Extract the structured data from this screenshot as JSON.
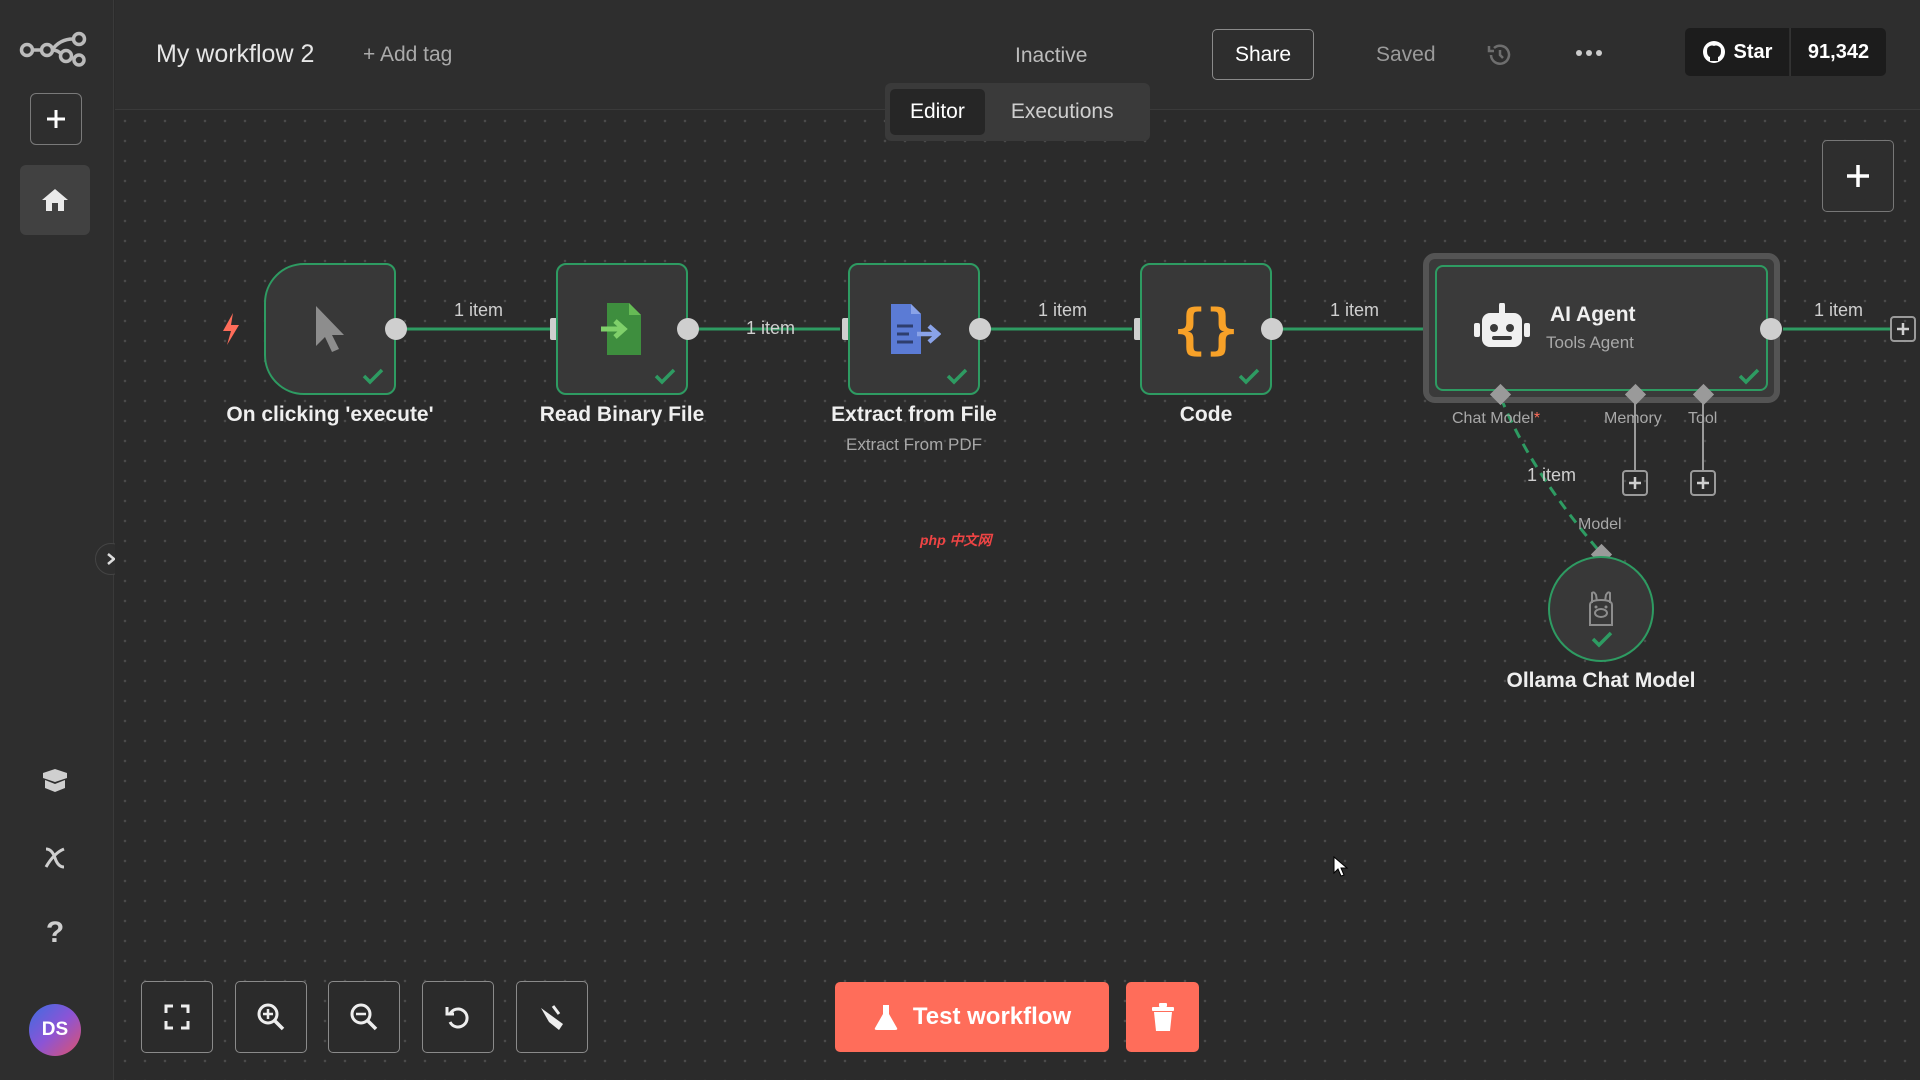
{
  "header": {
    "workflow_title": "My workflow 2",
    "add_tag": "+ Add tag",
    "status_label": "Inactive",
    "active": false,
    "share_label": "Share",
    "saved_label": "Saved",
    "github": {
      "star_label": "Star",
      "star_count": "91,342"
    }
  },
  "tabs": [
    {
      "label": "Editor",
      "active": true
    },
    {
      "label": "Executions",
      "active": false
    }
  ],
  "sidebar": {
    "items": [
      "add",
      "home",
      "templates",
      "variables",
      "help"
    ],
    "avatar_initials": "DS"
  },
  "nodes": {
    "trigger": {
      "label": "On clicking 'execute'"
    },
    "read_binary": {
      "label": "Read Binary File"
    },
    "extract": {
      "label": "Extract from File",
      "sublabel": "Extract From PDF"
    },
    "code": {
      "label": "Code"
    },
    "agent": {
      "label": "AI Agent",
      "sublabel": "Tools Agent",
      "inputs": {
        "chat_model": "Chat Model",
        "required_mark": "*",
        "memory": "Memory",
        "tool": "Tool"
      }
    },
    "ollama": {
      "label": "Ollama Chat Model",
      "input_label": "Model"
    }
  },
  "edges": {
    "e1": "1 item",
    "e2": "1 item",
    "e3": "1 item",
    "e4": "1 item",
    "e5": "1 item",
    "model_edge": "1 item"
  },
  "toolbar": {
    "test_label": "Test workflow"
  },
  "watermark": "php 中文网",
  "colors": {
    "accent": "#ff6d5a",
    "success": "#2e9b62",
    "trigger_bolt": "#ff6d5a",
    "read_icon": "#4caf50",
    "extract_icon": "#5b7bd5",
    "code_icon": "#f7a128"
  }
}
